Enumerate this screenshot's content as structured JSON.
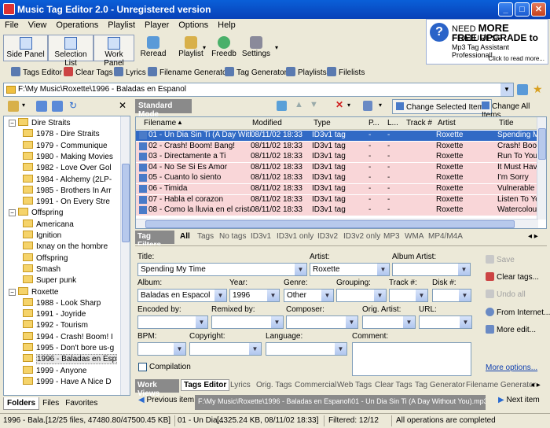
{
  "window": {
    "title": "Music Tag Editor 2.0 - Unregistered version"
  },
  "menu": [
    "File",
    "View",
    "Operations",
    "Playlist",
    "Player",
    "Options",
    "Help"
  ],
  "promo": {
    "line1_prefix": "NEED ",
    "line1_bold": "MORE",
    "line1_suffix": " FEATURES?",
    "line2": "FREE UPGRADE to",
    "line3": "Mp3 Tag Assistant Professional!",
    "line4": "Click to read more..."
  },
  "toolbar": {
    "side_panel": "Side Panel",
    "selection_list": "Selection List",
    "work_panel": "Work Panel",
    "reread": "Reread",
    "playlist": "Playlist",
    "freedb": "Freedb",
    "settings": "Settings"
  },
  "toolbar2": [
    "Tags Editor",
    "Clear Tags",
    "Lyrics",
    "Filename Generator",
    "Tag Generator",
    "Playlists",
    "Filelists"
  ],
  "path": "F:\\My Music\\Roxette\\1996 - Baladas en Espanol",
  "tree": [
    {
      "label": "Dire Straits",
      "level": 0,
      "toggle": "−"
    },
    {
      "label": "1978 - Dire Straits",
      "level": 1
    },
    {
      "label": "1979 - Communique",
      "level": 1
    },
    {
      "label": "1980 - Making Movies",
      "level": 1
    },
    {
      "label": "1982 - Love Over Gol",
      "level": 1
    },
    {
      "label": "1984 - Alchemy (2LP-",
      "level": 1
    },
    {
      "label": "1985 - Brothers In Arr",
      "level": 1
    },
    {
      "label": "1991 - On Every Stre",
      "level": 1
    },
    {
      "label": "Offspring",
      "level": 0,
      "toggle": "−"
    },
    {
      "label": "Americana",
      "level": 1
    },
    {
      "label": "Ignition",
      "level": 1
    },
    {
      "label": "Ixnay on the hombre",
      "level": 1
    },
    {
      "label": "Offspring",
      "level": 1
    },
    {
      "label": "Smash",
      "level": 1
    },
    {
      "label": "Super punk",
      "level": 1
    },
    {
      "label": "Roxette",
      "level": 0,
      "toggle": "−"
    },
    {
      "label": "1988 - Look Sharp",
      "level": 1
    },
    {
      "label": "1991 - Joyride",
      "level": 1
    },
    {
      "label": "1992 - Tourism",
      "level": 1
    },
    {
      "label": "1994 - Crash! Boom! I",
      "level": 1
    },
    {
      "label": "1995 - Don't bore us-g",
      "level": 1
    },
    {
      "label": "1996 - Baladas en Esp",
      "level": 1,
      "selected": true
    },
    {
      "label": "1999 - Anyone",
      "level": 1
    },
    {
      "label": "1999 - Have A Nice D",
      "level": 1
    }
  ],
  "left_tabs": [
    "Folders",
    "Files",
    "Favorites"
  ],
  "mode": {
    "label": "Standard Mode",
    "change_selected": "Change Selected Items",
    "change_all": "Change All Items"
  },
  "grid": {
    "columns": [
      "Filename",
      "Modified",
      "Type",
      "P...",
      "L...",
      "Track #",
      "Artist",
      "Title"
    ],
    "rows": [
      {
        "filename": "01 - Un Dia Sin Ti (A Day With...",
        "modified": "08/11/02 18:33",
        "type": "ID3v1 tag",
        "p": "-",
        "l": "-",
        "track": "",
        "artist": "Roxette",
        "title": "Spending My",
        "selected": true
      },
      {
        "filename": "02 - Crash! Boom! Bang!",
        "modified": "08/11/02 18:33",
        "type": "ID3v1 tag",
        "p": "-",
        "l": "-",
        "track": "",
        "artist": "Roxette",
        "title": "Crash! Boom"
      },
      {
        "filename": "03 - Directamente a Ti",
        "modified": "08/11/02 18:33",
        "type": "ID3v1 tag",
        "p": "-",
        "l": "-",
        "track": "",
        "artist": "Roxette",
        "title": "Run To You"
      },
      {
        "filename": "04 - No Se Si Es Amor",
        "modified": "08/11/02 18:33",
        "type": "ID3v1 tag",
        "p": "-",
        "l": "-",
        "track": "",
        "artist": "Roxette",
        "title": "It Must Have"
      },
      {
        "filename": "05 - Cuanto lo siento",
        "modified": "08/11/02 18:33",
        "type": "ID3v1 tag",
        "p": "-",
        "l": "-",
        "track": "",
        "artist": "Roxette",
        "title": "I'm Sorry"
      },
      {
        "filename": "06 - Timida",
        "modified": "08/11/02 18:33",
        "type": "ID3v1 tag",
        "p": "-",
        "l": "-",
        "track": "",
        "artist": "Roxette",
        "title": "Vulnerable"
      },
      {
        "filename": "07 - Habla el corazon",
        "modified": "08/11/02 18:33",
        "type": "ID3v1 tag",
        "p": "-",
        "l": "-",
        "track": "",
        "artist": "Roxette",
        "title": "Listen To Yo"
      },
      {
        "filename": "08 - Como la lluvia en el cristal",
        "modified": "08/11/02 18:33",
        "type": "ID3v1 tag",
        "p": "-",
        "l": "-",
        "track": "",
        "artist": "Roxette",
        "title": "Watercolours"
      }
    ]
  },
  "filters": {
    "label": "Tag Filters",
    "tabs": [
      "All",
      "Tags",
      "No tags",
      "ID3v1",
      "ID3v1 only",
      "ID3v2",
      "ID3v2 only",
      "MP3",
      "WMA",
      "MP4/M4A"
    ]
  },
  "editor": {
    "title_label": "Title:",
    "title_value": "Spending My Time",
    "artist_label": "Artist:",
    "artist_value": "Roxette",
    "album_artist_label": "Album Artist:",
    "album_label": "Album:",
    "album_value": "Baladas en Espacol",
    "year_label": "Year:",
    "year_value": "1996",
    "genre_label": "Genre:",
    "genre_value": "Other",
    "grouping_label": "Grouping:",
    "track_label": "Track #:",
    "disk_label": "Disk #:",
    "encoded_label": "Encoded by:",
    "remixed_label": "Remixed by:",
    "composer_label": "Composer:",
    "orig_artist_label": "Orig. Artist:",
    "url_label": "URL:",
    "bpm_label": "BPM:",
    "copyright_label": "Copyright:",
    "language_label": "Language:",
    "comment_label": "Comment:",
    "compilation_label": "Compilation"
  },
  "side_actions": {
    "save": "Save",
    "clear_tags": "Clear tags...",
    "undo_all": "Undo all",
    "from_internet": "From Internet...",
    "more_edit": "More edit...",
    "more_options": "More options..."
  },
  "work_views": {
    "label": "Work Views",
    "tabs": [
      "Tags Editor",
      "Lyrics",
      "Orig. Tags",
      "Commercial",
      "Web Tags",
      "Clear Tags",
      "Tag Generator",
      "Filename Generator"
    ]
  },
  "nav": {
    "previous": "Previous item",
    "next": "Next item",
    "current_file": "F:\\My Music\\Roxette\\1996 - Baladas en Espanol\\01 - Un Dia Sin Ti (A Day Without You).mp3"
  },
  "status": {
    "s1": "1996 - Bala...",
    "s2": "[12/25 files, 47480.80/47500.45 KB]",
    "s3": "01 - Un Dia...",
    "s4": "[4325.24 KB, 08/11/02 18:33]",
    "s5": "Filtered: 12/12",
    "s6": "All operations are completed"
  },
  "colors": {
    "title_bar": "#0a5fd8",
    "row_highlight": "#f9d6d8",
    "selection": "#316ac5"
  }
}
